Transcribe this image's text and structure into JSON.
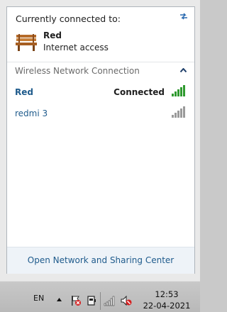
{
  "flyout": {
    "current_title": "Currently connected to:",
    "current_network": {
      "name": "Red",
      "status": "Internet access",
      "icon": "bench-icon"
    },
    "refresh_icon": "refresh-arrows-icon",
    "section": {
      "title": "Wireless Network Connection",
      "icon": "chevron-up-icon"
    },
    "networks": [
      {
        "name": "Red",
        "status": "Connected",
        "signal_bars": 5,
        "signal_color": "#2f9a2f"
      },
      {
        "name": "redmi 3",
        "status": "",
        "signal_bars": 5,
        "signal_color": "#9a9a9a"
      }
    ],
    "footer_link": "Open Network and Sharing Center"
  },
  "taskbar": {
    "language": "EN",
    "tray_icons": [
      "show-hidden-icons-arrow",
      "action-center-flag-icon",
      "power-icon",
      "network-signal-icon",
      "volume-muted-icon"
    ],
    "time": "12:53",
    "date": "22-04-2021"
  },
  "colors": {
    "link": "#1f5b8c",
    "signal_active": "#2f9a2f",
    "signal_inactive": "#9a9a9a"
  }
}
